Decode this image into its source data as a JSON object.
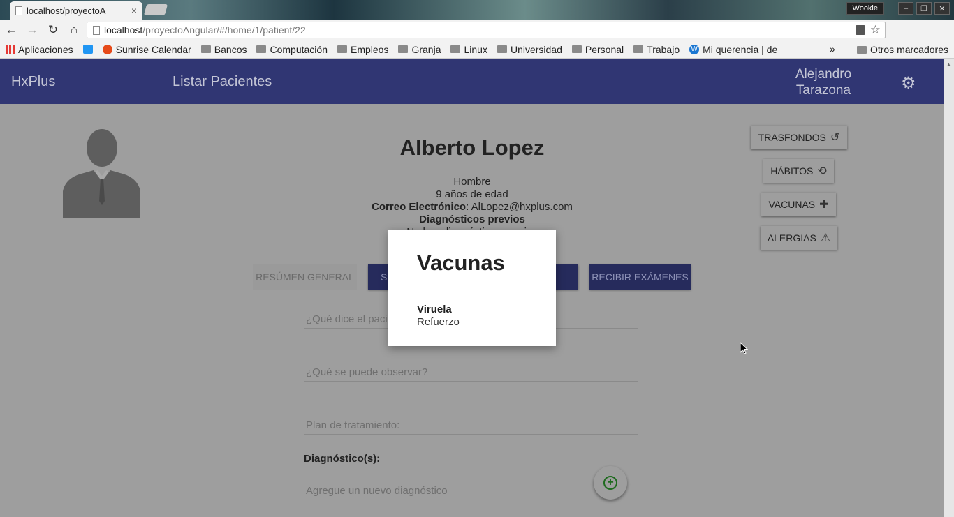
{
  "browser": {
    "tab_title": "localhost/proyectoA",
    "tab_close": "×",
    "profile": "Wookie",
    "url_host": "localhost",
    "url_path": "/proyectoAngular/#/home/1/patient/22",
    "bookmarks": [
      "Aplicaciones",
      "Sunrise Calendar",
      "Bancos",
      "Computación",
      "Empleos",
      "Granja",
      "Linux",
      "Universidad",
      "Personal",
      "Trabajo",
      "Mi querencia | de"
    ],
    "other_bookmarks": "Otros marcadores",
    "ext1_badge": "1",
    "ext2_badge": "?"
  },
  "appbar": {
    "brand": "HxPlus",
    "nav_link": "Listar Pacientes",
    "user_name": "Alejandro Tarazona"
  },
  "patient": {
    "name": "Alberto Lopez",
    "gender": "Hombre",
    "age": "9 años de edad",
    "email_label": "Correo Electrónico",
    "email": "AlLopez@hxplus.com",
    "prev_diag_label": "Diagnósticos previos",
    "prev_diag_hidden": "No hay diagnósticos previos"
  },
  "side_buttons": {
    "trasfondos": "TRASFONDOS",
    "habitos": "HÁBITOS",
    "vacunas": "VACUNAS",
    "alergias": "ALERGIAS"
  },
  "tabs": {
    "resumen": "RESÚMEN GENERAL",
    "signos": "SIGNOS VITALES",
    "ordenes": "ORDENAR EXÁMENES",
    "recibir": "RECIBIR EXÁMENES"
  },
  "form": {
    "subjective_placeholder": "¿Qué dice el paciente?",
    "objective_placeholder": "¿Qué se puede observar?",
    "plan_placeholder": "Plan de tratamiento:",
    "diagnosis_label": "Diagnóstico(s):",
    "new_diag_placeholder": "Agregue un nuevo diagnóstico"
  },
  "modal": {
    "title": "Vacunas",
    "vaccines": [
      {
        "name": "Viruela",
        "detail": "Refuerzo"
      }
    ]
  },
  "colors": {
    "appbar": "#303673",
    "backdrop": "#9e9e9e",
    "tab_active": "#262b5c"
  }
}
